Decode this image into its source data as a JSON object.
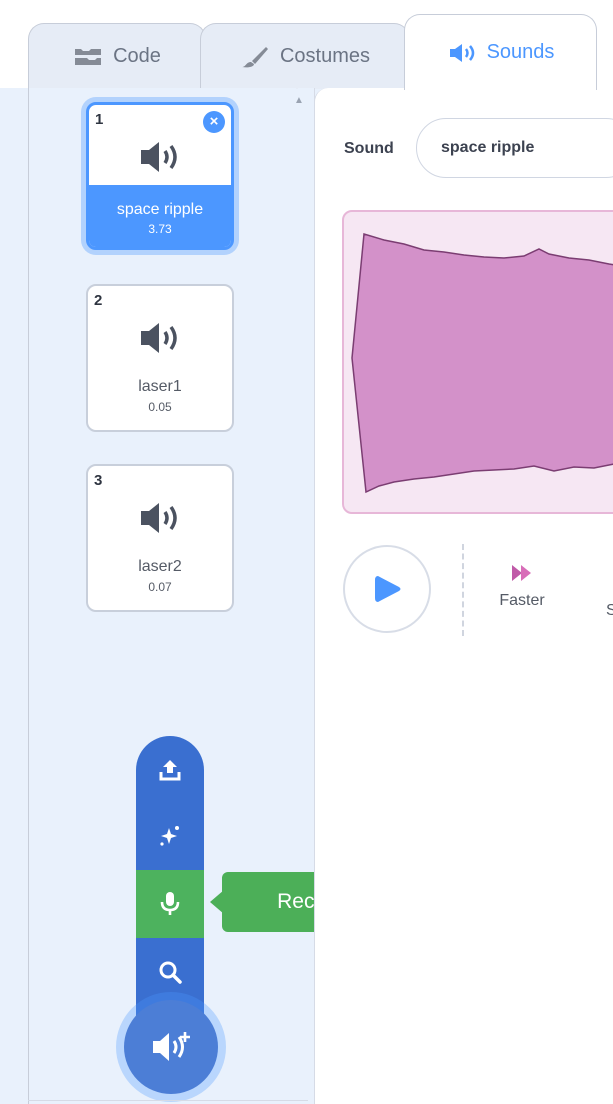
{
  "tabs": {
    "code": "Code",
    "costumes": "Costumes",
    "sounds": "Sounds"
  },
  "sounds": [
    {
      "index": "1",
      "name": "space ripple",
      "duration": "3.73",
      "selected": true
    },
    {
      "index": "2",
      "name": "laser1",
      "duration": "0.05",
      "selected": false
    },
    {
      "index": "3",
      "name": "laser2",
      "duration": "0.07",
      "selected": false
    }
  ],
  "editor": {
    "sound_label": "Sound",
    "sound_name": "space ripple",
    "effects": {
      "faster": "Faster",
      "next_partial": "S"
    }
  },
  "add_menu": {
    "tooltip": "Record",
    "items": [
      "upload-icon",
      "surprise-icon",
      "microphone-icon",
      "search-icon"
    ]
  },
  "colors": {
    "accent": "#4c97ff",
    "menu_blue": "#3a6fd0",
    "record_green": "#4db25e",
    "wave_fill": "#d391c9",
    "wave_bg": "#f6e7f3"
  }
}
